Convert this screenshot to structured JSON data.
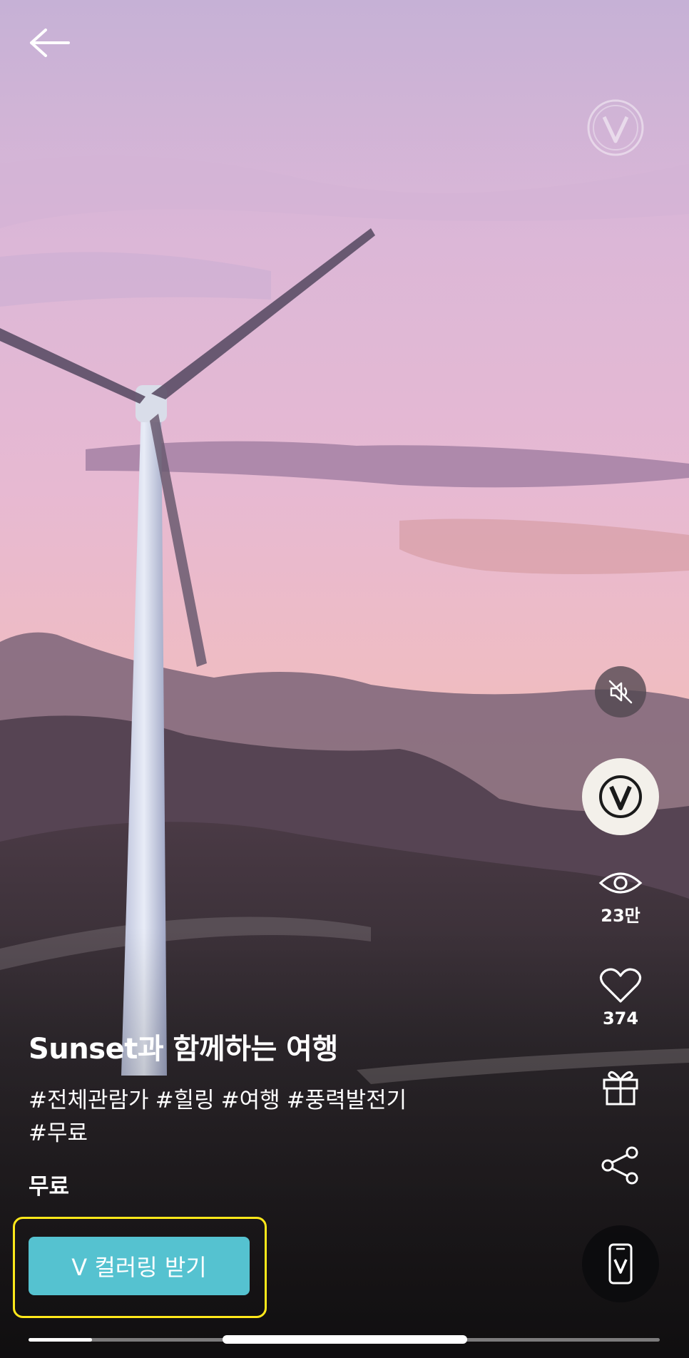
{
  "video": {
    "title": "Sunset과 함께하는 여행",
    "tags": [
      "#전체관람가",
      "#힐링",
      "#여행",
      "#풍력발전기",
      "#무료"
    ],
    "price": "무료",
    "cta_label": "V 컬러링 받기",
    "progress": 0.1
  },
  "stats": {
    "views": "23만",
    "likes": "374"
  },
  "icons": {
    "back": "arrow-left-icon",
    "watermark": "v-logo-icon",
    "mute": "speaker-muted-icon",
    "vcolor": "v-circle-icon",
    "views": "eye-icon",
    "likes": "heart-icon",
    "gift": "gift-icon",
    "share": "share-icon",
    "phone": "phone-v-icon"
  },
  "colors": {
    "cta": "#55c2d0",
    "highlight": "#ffe81a",
    "sky_top": "#c9b0d4",
    "sky_horizon": "#f4c79c"
  }
}
